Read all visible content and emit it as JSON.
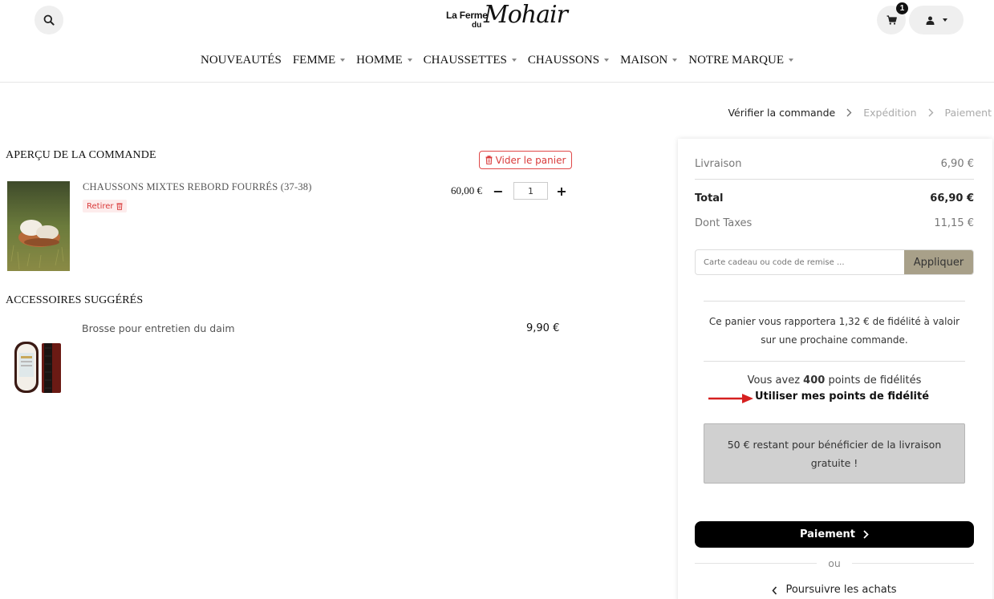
{
  "header": {
    "logo": {
      "top": "La Ferme",
      "du": "du",
      "script": "Mohair"
    },
    "cart_count": "1"
  },
  "nav": {
    "items": [
      {
        "label": "NOUVEAUTÉS",
        "has_caret": false
      },
      {
        "label": "FEMME",
        "has_caret": true
      },
      {
        "label": "HOMME",
        "has_caret": true
      },
      {
        "label": "CHAUSSETTES",
        "has_caret": true
      },
      {
        "label": "CHAUSSONS",
        "has_caret": true
      },
      {
        "label": "MAISON",
        "has_caret": true
      },
      {
        "label": "NOTRE MARQUE",
        "has_caret": true
      }
    ]
  },
  "steps": {
    "step1": "Vérifier la commande",
    "step2": "Expédition",
    "step3": "Paiement"
  },
  "order": {
    "title": "APERÇU DE LA COMMANDE",
    "clear_label": "Vider le panier",
    "item": {
      "name": "CHAUSSONS MIXTES REBORD FOURRÉS (37-38)",
      "remove_label": "Retirer",
      "price": "60,00 €",
      "qty": "1",
      "minus": "−",
      "plus": "+"
    }
  },
  "accessories": {
    "title": "ACCESSOIRES SUGGÉRÉS",
    "item": {
      "name": "Brosse pour entretien du daim",
      "price": "9,90 €"
    }
  },
  "summary": {
    "shipping_label": "Livraison",
    "shipping_value": "6,90 €",
    "total_label": "Total",
    "total_value": "66,90 €",
    "tax_label": "Dont Taxes",
    "tax_value": "11,15 €",
    "coupon_placeholder": "Carte cadeau ou code de remise ...",
    "apply_label": "Appliquer",
    "loyalty_line1": "Ce panier vous rapportera 1,32 € de fidélité à valoir",
    "loyalty_line2": "sur une prochaine commande.",
    "points_prefix": "Vous avez ",
    "points_value": "400",
    "points_suffix": " points de fidélités",
    "use_points_label": "Utiliser mes points de fidélité",
    "free_line1": "50 € restant pour bénéficier de la livraison",
    "free_line2": "gratuite !",
    "pay_label": "Paiement",
    "or_label": "ou",
    "continue_label": "Poursuivre les achats"
  },
  "colors": {
    "danger": "#d93a3a",
    "apply_bg": "#a8a089",
    "arrow": "#d62020"
  }
}
